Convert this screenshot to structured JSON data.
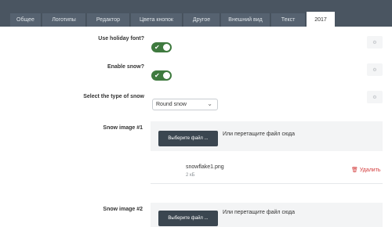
{
  "tabs": [
    {
      "label": "Общее"
    },
    {
      "label": "Логотипы"
    },
    {
      "label": "Редактор"
    },
    {
      "label": "Цвета кнопок"
    },
    {
      "label": "Другое"
    },
    {
      "label": "Внешний вид"
    },
    {
      "label": "Текст"
    },
    {
      "label": "2017",
      "active": true
    }
  ],
  "settings": {
    "holiday_font": {
      "label": "Use holiday font?",
      "enabled": true,
      "check": "✔"
    },
    "enable_snow": {
      "label": "Enable snow?",
      "enabled": true,
      "check": "✔"
    },
    "snow_type": {
      "label": "Select the type of snow",
      "value": "Round snow",
      "chevron": "⌄"
    },
    "snow_image_1": {
      "label": "Snow image #1",
      "button": "Выберите файл ...",
      "drop_text": "Или перетащите файл сюда",
      "file_name": "snowflake1.png",
      "file_size": "2 кБ",
      "delete_label": "🗑 Удалить"
    },
    "snow_image_2": {
      "label": "Snow image #2",
      "button": "Выберите файл ...",
      "drop_text": "Или перетащите файл сюда"
    }
  },
  "gear_glyph": "⚙",
  "colors": {
    "tab_bar": "#4a5561",
    "toggle_on": "#3f7a3f",
    "upload_button": "#3b4650",
    "delete": "#d33b3b"
  }
}
